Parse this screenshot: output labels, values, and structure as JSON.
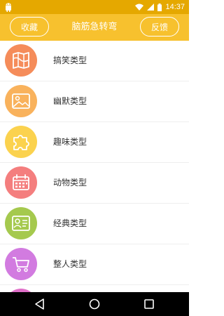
{
  "status_bar": {
    "time": "14:37",
    "icons": [
      "android-icon",
      "wifi-icon",
      "signal-icon",
      "battery-icon"
    ]
  },
  "app_bar": {
    "left_button": "收藏",
    "title": "脑筋急转弯",
    "right_button": "反馈"
  },
  "categories": [
    {
      "label": "搞笑类型",
      "icon": "map-icon",
      "color": "#f58c5a"
    },
    {
      "label": "幽默类型",
      "icon": "image-icon",
      "color": "#f9b25c"
    },
    {
      "label": "趣味类型",
      "icon": "puzzle-icon",
      "color": "#fbd24e"
    },
    {
      "label": "动物类型",
      "icon": "calendar-icon",
      "color": "#f47e7e"
    },
    {
      "label": "经典类型",
      "icon": "id-card-icon",
      "color": "#a5c94e"
    },
    {
      "label": "整人类型",
      "icon": "cart-icon",
      "color": "#d27be0"
    },
    {
      "label": "",
      "icon": "partial-icon",
      "color": "#e06fc8"
    }
  ],
  "nav_bar": {
    "buttons": [
      "back-icon",
      "home-icon",
      "recent-apps-icon"
    ]
  }
}
